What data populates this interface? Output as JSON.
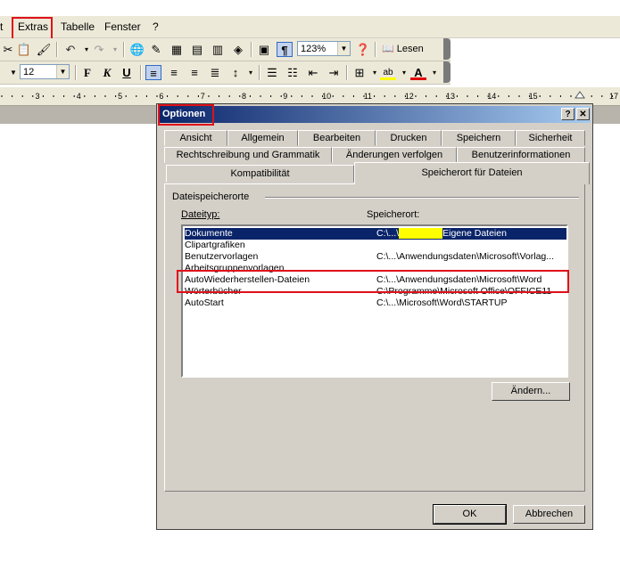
{
  "menubar": {
    "items": [
      {
        "label": "t"
      },
      {
        "label": "Extras"
      },
      {
        "label": "Tabelle"
      },
      {
        "label": "Fenster"
      },
      {
        "label": "?"
      }
    ]
  },
  "toolbar1": {
    "zoom": "123%",
    "read_label": "Lesen",
    "paragraph_mark": "¶"
  },
  "toolbar2": {
    "font_size": "12",
    "bold": "F",
    "italic": "K",
    "underline": "U"
  },
  "ruler": {
    "labels": [
      "3",
      "4",
      "5",
      "6",
      "7",
      "8",
      "9",
      "10",
      "11",
      "12",
      "13",
      "14",
      "15",
      "17"
    ]
  },
  "dialog": {
    "title": "Optionen",
    "help_button": "?",
    "close_button": "✕",
    "tabs_row1": [
      "Ansicht",
      "Allgemein",
      "Bearbeiten",
      "Drucken",
      "Speichern",
      "Sicherheit"
    ],
    "tabs_row2": [
      "Rechtschreibung und Grammatik",
      "Änderungen verfolgen",
      "Benutzerinformationen"
    ],
    "tabs_row3": [
      "Kompatibilität",
      "Speicherort für Dateien"
    ],
    "active_tab": "Speicherort für Dateien",
    "group_label": "Dateispeicherorte",
    "col_type": "Dateityp:",
    "col_location": "Speicherort:",
    "rows": [
      {
        "type": "Dokumente",
        "location_prefix": "C:\\...\\",
        "location_hidden": "XXXXXXX",
        "location_suffix": "Eigene Dateien",
        "selected": true
      },
      {
        "type": "Clipartgrafiken",
        "location": ""
      },
      {
        "type": "Benutzervorlagen",
        "location": "C:\\...\\Anwendungsdaten\\Microsoft\\Vorlag..."
      },
      {
        "type": "Arbeitsgruppenvorlagen",
        "location": ""
      },
      {
        "type": "AutoWiederherstellen-Dateien",
        "location": "C:\\...\\Anwendungsdaten\\Microsoft\\Word"
      },
      {
        "type": "Wörterbücher",
        "location": "C:\\Programme\\Microsoft Office\\OFFICE11"
      },
      {
        "type": "AutoStart",
        "location": "C:\\...\\Microsoft\\Word\\STARTUP"
      }
    ],
    "change_button": "Ändern...",
    "ok_button": "OK",
    "cancel_button": "Abbrechen"
  },
  "colors": {
    "highlight_box": "#e0101a",
    "title_gradient_start": "#0a246a",
    "title_gradient_end": "#a6caf0",
    "selection": "#0a246a"
  }
}
